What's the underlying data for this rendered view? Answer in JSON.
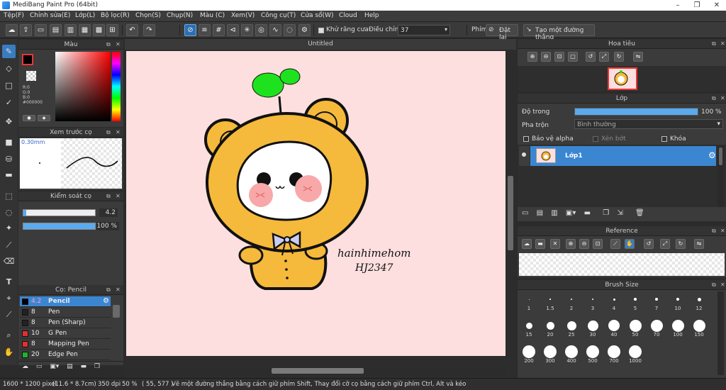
{
  "app": {
    "title": "MediBang Paint Pro (64bit)"
  },
  "menu": [
    "Tệp(F)",
    "Chỉnh sửa(E)",
    "Lớp(L)",
    "Bộ lọc(R)",
    "Chọn(S)",
    "Chụp(N)",
    "Màu (C)",
    "Xem(V)",
    "Công cụ(T)",
    "Cửa sổ(W)",
    "Cloud",
    "Help"
  ],
  "toolbar": {
    "antialias_label": "Khử răng cưa",
    "adjust_label": "Điều chỉnh",
    "adjust_value": "37",
    "key_label": "Phím",
    "set_label": "Đặt lại",
    "straight_label": "Tạo một đường thẳng"
  },
  "color_panel": {
    "title": "Màu",
    "rgb_text": "R:0\nG:0\nB:0\n#000000",
    "fg_color": "#000000"
  },
  "preview_panel": {
    "title": "Xem trước cọ",
    "size": "0.30mm"
  },
  "control_panel": {
    "title": "Kiểm soát cọ",
    "size_value": "4.2",
    "opacity_value": "100 %",
    "opacity": 1.0
  },
  "brush_panel": {
    "title": "Cọ: Pencil",
    "items": [
      {
        "size": "4.2",
        "name": "Pencil",
        "color": "#000000",
        "active": true
      },
      {
        "size": "8",
        "name": "Pen",
        "color": "#222222"
      },
      {
        "size": "8",
        "name": "Pen (Sharp)",
        "color": "#222222"
      },
      {
        "size": "10",
        "name": "G Pen",
        "color": "#e03030"
      },
      {
        "size": "8",
        "name": "Mapping Pen",
        "color": "#e03030"
      },
      {
        "size": "20",
        "name": "Edge Pen",
        "color": "#20b030"
      }
    ]
  },
  "canvas": {
    "tab": "Untitled",
    "signature_line1": "hainhimehom",
    "signature_line2": "HJ2347"
  },
  "navigator": {
    "title": "Hoa tiêu"
  },
  "layer_panel": {
    "title": "Lớp",
    "opacity_label": "Độ trong",
    "opacity_value": "100 %",
    "blend_label": "Pha trộn",
    "blend_value": "Bình thường",
    "protect_alpha": "Bảo vệ alpha",
    "clip": "Xén bớt",
    "lock": "Khóa",
    "layer_name": "Lớp1"
  },
  "reference": {
    "title": "Reference"
  },
  "brush_size": {
    "title": "Brush Size",
    "sizes": [
      "1",
      "1.5",
      "2",
      "3",
      "4",
      "5",
      "7",
      "10",
      "12",
      "15",
      "20",
      "25",
      "30",
      "40",
      "50",
      "70",
      "100",
      "150",
      "200",
      "300",
      "400",
      "500",
      "700",
      "1000"
    ]
  },
  "status": {
    "dimensions": "1600 * 1200 pixel",
    "physical": "(11.6 * 8.7cm)",
    "dpi": "350 dpi",
    "zoom": "50 %",
    "coords": "( 55, 577 )",
    "hint": "Vẽ một đường thẳng bằng cách giữ phím Shift, Thay đổi cỡ cọ bằng cách giữ phím Ctrl, Alt và kéo"
  }
}
